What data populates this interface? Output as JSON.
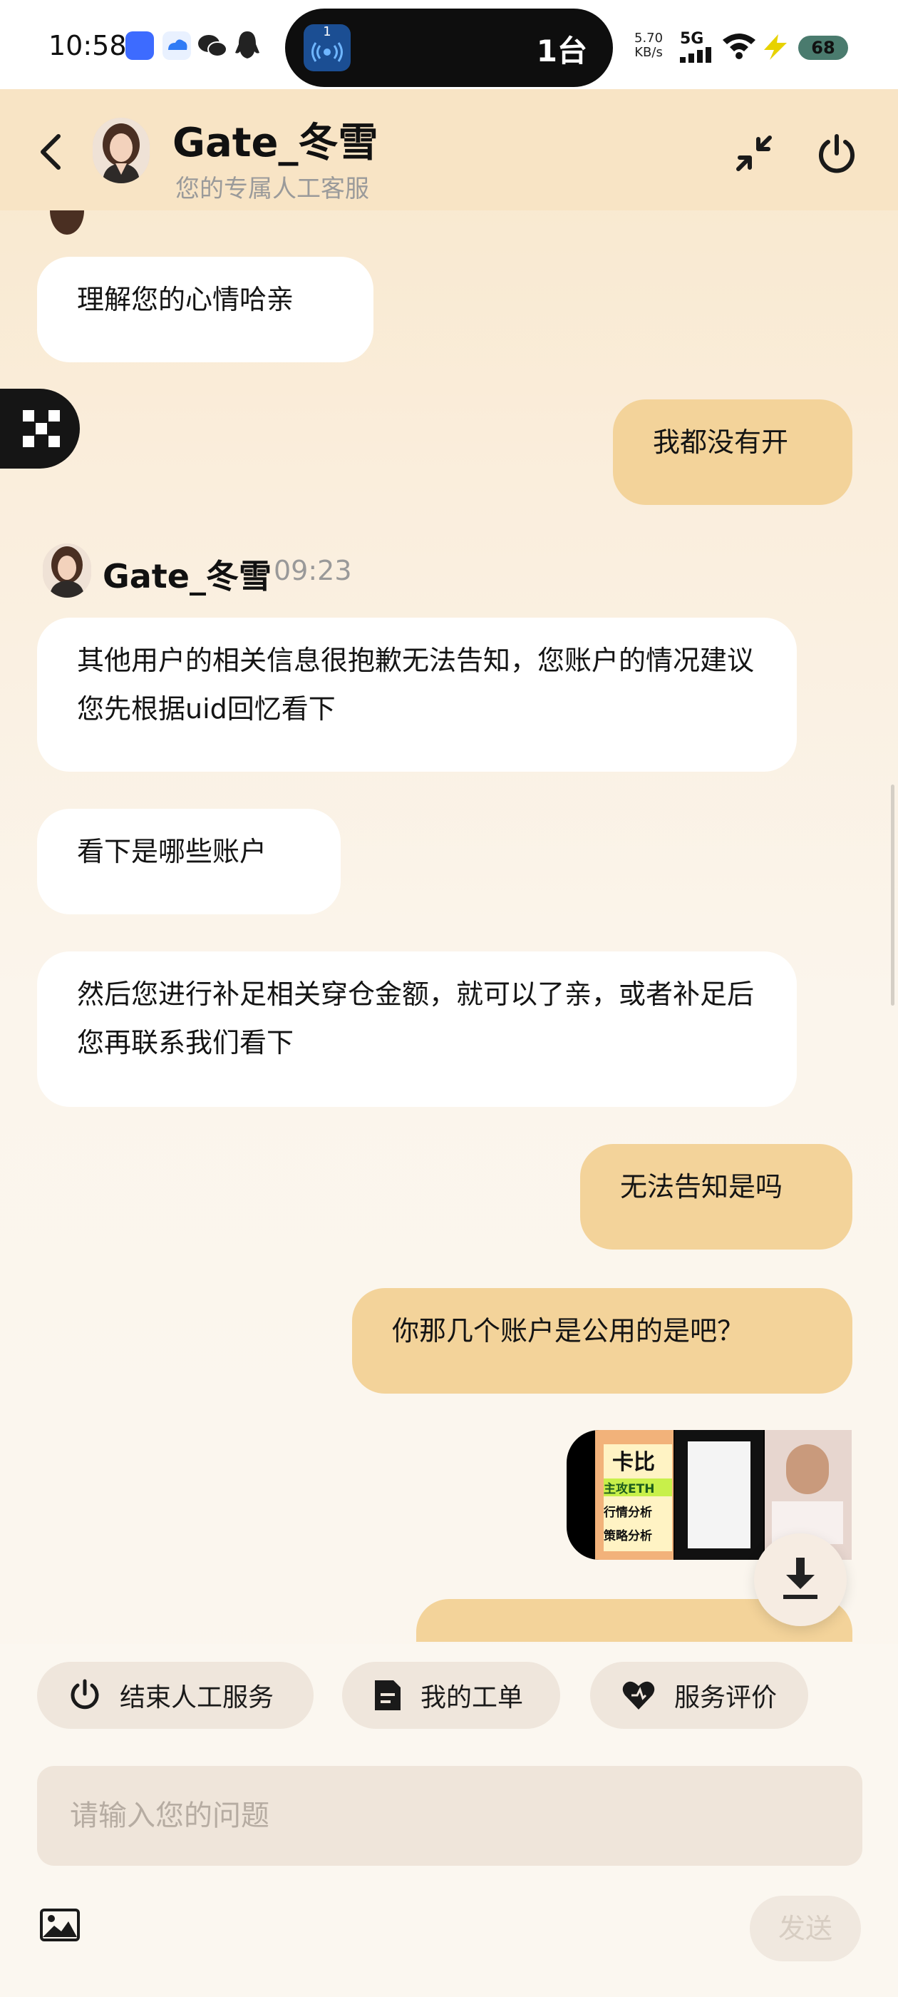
{
  "status_bar": {
    "time": "10:58",
    "island_text": "1台",
    "island_icon_digit": "1",
    "net_speed_value": "5.70",
    "net_speed_unit": "KB/s",
    "signal_label": "5G",
    "battery": "68"
  },
  "header": {
    "agent_name": "Gate_冬雪",
    "subtitle": "您的专属人工客服"
  },
  "messages": [
    {
      "role": "agent",
      "text": "理解您的心情哈亲"
    },
    {
      "role": "user",
      "text": "我都没有开"
    },
    {
      "role": "agent_header",
      "name": "Gate_冬雪",
      "time": "09:23"
    },
    {
      "role": "agent",
      "text": "其他用户的相关信息很抱歉无法告知，您账户的情况建议您先根据uid回忆看下"
    },
    {
      "role": "agent",
      "text": "看下是哪些账户"
    },
    {
      "role": "agent",
      "text": "然后您进行补足相关穿仓金额，就可以了亲，或者补足后您再联系我们看下"
    },
    {
      "role": "user",
      "text": "无法告知是吗"
    },
    {
      "role": "user",
      "text": "你那几个账户是公用的是吧？"
    }
  ],
  "image_thumb_texts": [
    "卡比",
    "主攻ETH",
    "行情分析",
    "策略分析"
  ],
  "toolbar": {
    "end_service": "结束人工服务",
    "my_tickets": "我的工单",
    "rate_service": "服务评价"
  },
  "composer": {
    "placeholder": "请输入您的问题",
    "send_label": "发送"
  },
  "colors": {
    "user_bubble": "#f3d39a",
    "agent_bubble": "#ffffff",
    "header_bg": "#f8e4c5"
  }
}
